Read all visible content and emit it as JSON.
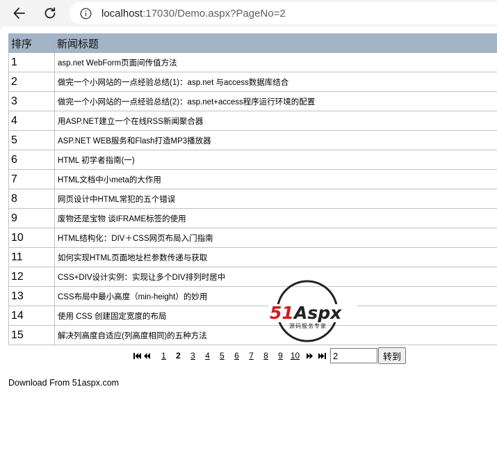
{
  "browser": {
    "url_host": "localhost",
    "url_rest": ":17030/Demo.aspx?PageNo=2",
    "icons": {
      "back": "arrow-left-icon",
      "reload": "reload-icon",
      "info": "info-icon"
    }
  },
  "table": {
    "headers": [
      "排序",
      "新闻标题"
    ],
    "rows": [
      {
        "num": "1",
        "title": "asp.net WebForm页面间传值方法"
      },
      {
        "num": "2",
        "title": "做完一个小网站的一点经验总结(1)：asp.net 与access数据库结合"
      },
      {
        "num": "3",
        "title": "做完一个小网站的一点经验总结(2)：asp.net+access程序运行环境的配置"
      },
      {
        "num": "4",
        "title": "用ASP.NET建立一个在线RSS新闻聚合器"
      },
      {
        "num": "5",
        "title": "ASP.NET WEB服务和Flash打造MP3播放器"
      },
      {
        "num": "6",
        "title": "HTML 初学者指南(一)"
      },
      {
        "num": "7",
        "title": "HTML文档中小meta的大作用"
      },
      {
        "num": "8",
        "title": "网页设计中HTML常犯的五个错误"
      },
      {
        "num": "9",
        "title": "废物还是宝物 谈IFRAME标签的使用"
      },
      {
        "num": "10",
        "title": "HTML结构化：DIV＋CSS网页布局入门指南"
      },
      {
        "num": "11",
        "title": "如何实现HTML页面地址栏参数传递与获取"
      },
      {
        "num": "12",
        "title": "CSS+DIV设计实例：实现让多个DIV排列时居中"
      },
      {
        "num": "13",
        "title": "CSS布局中最小高度（min-height）的妙用"
      },
      {
        "num": "14",
        "title": "使用 CSS 创建固定宽度的布局"
      },
      {
        "num": "15",
        "title": "解决列高度自适应(列高度相同)的五种方法"
      }
    ]
  },
  "pager": {
    "first_icon": "first-page-icon",
    "prev_icon": "prev-page-icon",
    "next_icon": "next-page-icon",
    "last_icon": "last-page-icon",
    "pages": [
      "1",
      "2",
      "3",
      "4",
      "5",
      "6",
      "7",
      "8",
      "9",
      "10"
    ],
    "current_page": "2",
    "input_value": "2",
    "go_label": "转到"
  },
  "footer": {
    "text": "Download From 51aspx.com"
  },
  "watermark": {
    "brand": "51Aspx",
    "tagline": "源码服务专家",
    "colors": {
      "red": "#d11d1d",
      "green": "#3a8f2a",
      "ring": "#222222"
    }
  }
}
